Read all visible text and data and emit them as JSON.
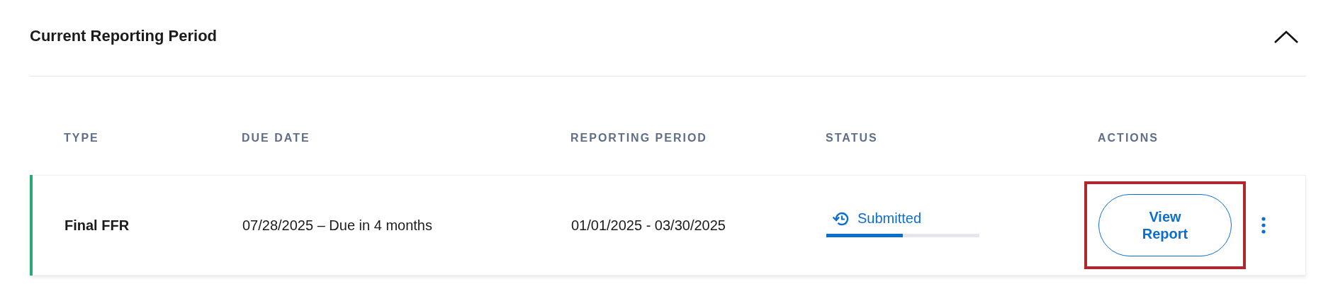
{
  "section": {
    "title": "Current Reporting Period",
    "expanded": true
  },
  "table": {
    "columns": [
      "TYPE",
      "DUE DATE",
      "REPORTING PERIOD",
      "STATUS",
      "ACTIONS"
    ],
    "rows": [
      {
        "type": "Final FFR",
        "due_date": "07/28/2025 – Due in 4 months",
        "reporting_period": "01/01/2025 - 03/30/2025",
        "status": {
          "kind": "submitted",
          "label": "Submitted",
          "level": 0.5
        },
        "action": {
          "label": "View Report",
          "highlighted": true
        },
        "color": "#2aa876"
      }
    ]
  }
}
